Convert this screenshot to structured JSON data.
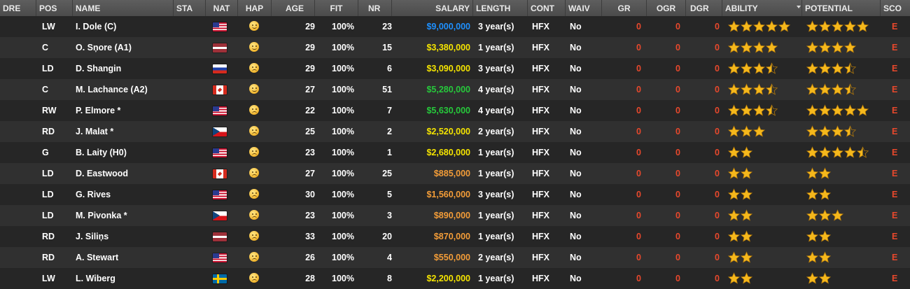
{
  "columns": {
    "dre": "DRE",
    "pos": "POS",
    "name": "NAME",
    "sta": "STA",
    "nat": "NAT",
    "hap": "HAP",
    "age": "AGE",
    "fit": "FIT",
    "nr": "NR",
    "salary": "SALARY",
    "length": "LENGTH",
    "cont": "CONT",
    "waiv": "WAIV",
    "gr": "GR",
    "ogr": "OGR",
    "dgr": "DGR",
    "ability": "ABILITY",
    "potential": "POTENTIAL",
    "scout": "SCO"
  },
  "sort": {
    "column": "ability",
    "direction": "desc"
  },
  "colors": {
    "star": "#f5b81c",
    "salary_blue": "#1e90ff",
    "salary_yellow": "#f5e400",
    "salary_green": "#26c93b",
    "salary_orange": "#f29c38",
    "zero": "#e8482c"
  },
  "players": [
    {
      "pos": "LW",
      "name": "I. Dole (C)",
      "nat": "us",
      "hap": "happy",
      "age": "29",
      "fit": "100%",
      "nr": "23",
      "salary": "$9,000,000",
      "salary_color": "blue",
      "length": "3 year(s)",
      "cont": "HFX",
      "waiv": "No",
      "gr": "0",
      "ogr": "0",
      "dgr": "0",
      "ability": 5,
      "potential": 5,
      "scout": "E"
    },
    {
      "pos": "C",
      "name": "O. Sņore (A1)",
      "nat": "lv",
      "hap": "content",
      "age": "29",
      "fit": "100%",
      "nr": "15",
      "salary": "$3,380,000",
      "salary_color": "yellow",
      "length": "1 year(s)",
      "cont": "HFX",
      "waiv": "No",
      "gr": "0",
      "ogr": "0",
      "dgr": "0",
      "ability": 4,
      "potential": 4,
      "scout": "E"
    },
    {
      "pos": "LD",
      "name": "D. Shangin",
      "nat": "ru",
      "hap": "unhappy",
      "age": "29",
      "fit": "100%",
      "nr": "6",
      "salary": "$3,090,000",
      "salary_color": "yellow",
      "length": "3 year(s)",
      "cont": "HFX",
      "waiv": "No",
      "gr": "0",
      "ogr": "0",
      "dgr": "0",
      "ability": 3.5,
      "potential": 3.5,
      "scout": "E"
    },
    {
      "pos": "C",
      "name": "M. Lachance (A2)",
      "nat": "ca",
      "hap": "content",
      "age": "27",
      "fit": "100%",
      "nr": "51",
      "salary": "$5,280,000",
      "salary_color": "green",
      "length": "4 year(s)",
      "cont": "HFX",
      "waiv": "No",
      "gr": "0",
      "ogr": "0",
      "dgr": "0",
      "ability": 3.5,
      "potential": 3.5,
      "scout": "E"
    },
    {
      "pos": "RW",
      "name": "P. Elmore *",
      "nat": "us",
      "hap": "unhappy",
      "age": "22",
      "fit": "100%",
      "nr": "7",
      "salary": "$5,630,000",
      "salary_color": "green",
      "length": "4 year(s)",
      "cont": "HFX",
      "waiv": "No",
      "gr": "0",
      "ogr": "0",
      "dgr": "0",
      "ability": 3.5,
      "potential": 5,
      "scout": "E"
    },
    {
      "pos": "RD",
      "name": "J. Malat *",
      "nat": "cz",
      "hap": "unhappy",
      "age": "25",
      "fit": "100%",
      "nr": "2",
      "salary": "$2,520,000",
      "salary_color": "yellow",
      "length": "2 year(s)",
      "cont": "HFX",
      "waiv": "No",
      "gr": "0",
      "ogr": "0",
      "dgr": "0",
      "ability": 3,
      "potential": 3.5,
      "scout": "E"
    },
    {
      "pos": "G",
      "name": "B. Laity (H0)",
      "nat": "us",
      "hap": "unhappy",
      "age": "23",
      "fit": "100%",
      "nr": "1",
      "salary": "$2,680,000",
      "salary_color": "yellow",
      "length": "1 year(s)",
      "cont": "HFX",
      "waiv": "No",
      "gr": "0",
      "ogr": "0",
      "dgr": "0",
      "ability": 2,
      "potential": 4.5,
      "scout": "E"
    },
    {
      "pos": "LD",
      "name": "D. Eastwood",
      "nat": "ca",
      "hap": "unhappy",
      "age": "27",
      "fit": "100%",
      "nr": "25",
      "salary": "$885,000",
      "salary_color": "orange",
      "length": "1 year(s)",
      "cont": "HFX",
      "waiv": "No",
      "gr": "0",
      "ogr": "0",
      "dgr": "0",
      "ability": 2,
      "potential": 2,
      "scout": "E"
    },
    {
      "pos": "LD",
      "name": "G. Rives",
      "nat": "us",
      "hap": "unhappy",
      "age": "30",
      "fit": "100%",
      "nr": "5",
      "salary": "$1,560,000",
      "salary_color": "orange",
      "length": "3 year(s)",
      "cont": "HFX",
      "waiv": "No",
      "gr": "0",
      "ogr": "0",
      "dgr": "0",
      "ability": 2,
      "potential": 2,
      "scout": "E"
    },
    {
      "pos": "LD",
      "name": "M. Pivonka *",
      "nat": "cz",
      "hap": "unhappy",
      "age": "23",
      "fit": "100%",
      "nr": "3",
      "salary": "$890,000",
      "salary_color": "orange",
      "length": "1 year(s)",
      "cont": "HFX",
      "waiv": "No",
      "gr": "0",
      "ogr": "0",
      "dgr": "0",
      "ability": 2,
      "potential": 3,
      "scout": "E"
    },
    {
      "pos": "RD",
      "name": "J. Siliņs",
      "nat": "lv",
      "hap": "unhappy",
      "age": "33",
      "fit": "100%",
      "nr": "20",
      "salary": "$870,000",
      "salary_color": "orange",
      "length": "1 year(s)",
      "cont": "HFX",
      "waiv": "No",
      "gr": "0",
      "ogr": "0",
      "dgr": "0",
      "ability": 2,
      "potential": 2,
      "scout": "E"
    },
    {
      "pos": "RD",
      "name": "A. Stewart",
      "nat": "us",
      "hap": "unhappy",
      "age": "26",
      "fit": "100%",
      "nr": "4",
      "salary": "$550,000",
      "salary_color": "orange",
      "length": "2 year(s)",
      "cont": "HFX",
      "waiv": "No",
      "gr": "0",
      "ogr": "0",
      "dgr": "0",
      "ability": 2,
      "potential": 2,
      "scout": "E"
    },
    {
      "pos": "LW",
      "name": "L. Wiberg",
      "nat": "se",
      "hap": "unhappy",
      "age": "28",
      "fit": "100%",
      "nr": "8",
      "salary": "$2,200,000",
      "salary_color": "yellow",
      "length": "1 year(s)",
      "cont": "HFX",
      "waiv": "No",
      "gr": "0",
      "ogr": "0",
      "dgr": "0",
      "ability": 2,
      "potential": 2,
      "scout": "E"
    }
  ]
}
